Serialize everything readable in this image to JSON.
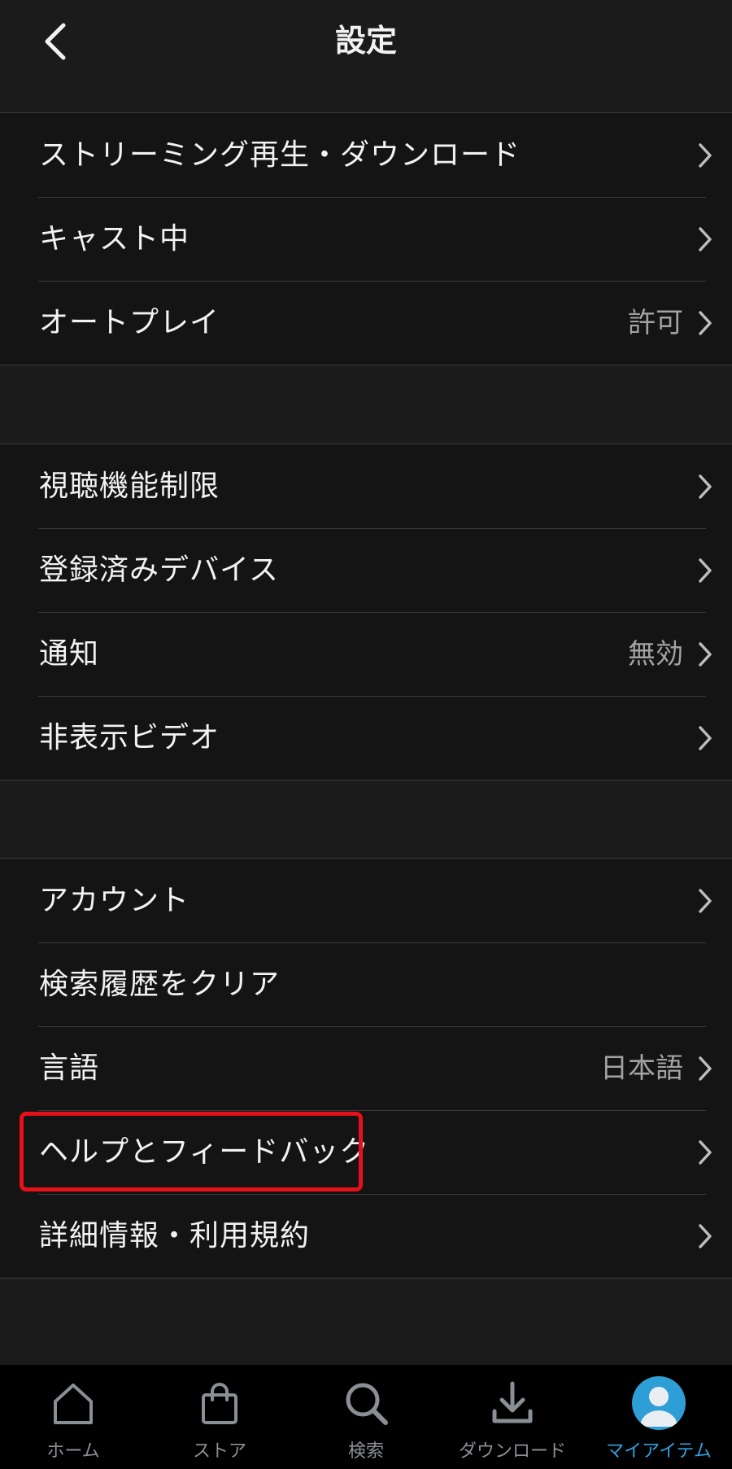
{
  "header": {
    "title": "設定"
  },
  "sections": [
    {
      "rows": [
        {
          "label": "ストリーミング再生・ダウンロード",
          "value": ""
        },
        {
          "label": "キャスト中",
          "value": ""
        },
        {
          "label": "オートプレイ",
          "value": "許可"
        }
      ]
    },
    {
      "rows": [
        {
          "label": "視聴機能制限",
          "value": ""
        },
        {
          "label": "登録済みデバイス",
          "value": ""
        },
        {
          "label": "通知",
          "value": "無効"
        },
        {
          "label": "非表示ビデオ",
          "value": ""
        }
      ]
    },
    {
      "rows": [
        {
          "label": "アカウント",
          "value": ""
        },
        {
          "label": "検索履歴をクリア",
          "value": ""
        },
        {
          "label": "言語",
          "value": "日本語"
        },
        {
          "label": "ヘルプとフィードバック",
          "value": ""
        },
        {
          "label": "詳細情報・利用規約",
          "value": ""
        }
      ]
    }
  ],
  "tabbar": {
    "tabs": [
      {
        "label": "ホーム",
        "icon": "home-icon"
      },
      {
        "label": "ストア",
        "icon": "shopping-bag-icon"
      },
      {
        "label": "検索",
        "icon": "search-icon"
      },
      {
        "label": "ダウンロード",
        "icon": "download-icon"
      },
      {
        "label": "マイアイテム",
        "icon": "avatar-icon"
      }
    ],
    "active_index": 4
  },
  "colors": {
    "accent": "#2f9fe0",
    "highlight": "#e5101a",
    "background": "#1b1b1b",
    "list_background": "#141414",
    "secondary_text": "#a3a3a3"
  }
}
